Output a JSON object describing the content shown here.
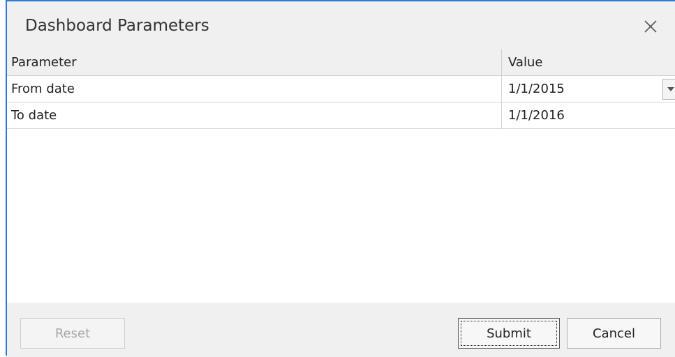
{
  "dialog": {
    "title": "Dashboard Parameters"
  },
  "grid": {
    "columns": {
      "parameter": "Parameter",
      "value": "Value"
    },
    "rows": [
      {
        "parameter": "From date",
        "value": "1/1/2015",
        "has_dropdown": true
      },
      {
        "parameter": "To date",
        "value": "1/1/2016",
        "has_dropdown": false
      }
    ]
  },
  "buttons": {
    "reset": "Reset",
    "submit": "Submit",
    "cancel": "Cancel"
  },
  "colors": {
    "accent_border": "#2b7ad6",
    "disabled_text": "#a8a8a8"
  },
  "icons": {
    "close": "close-icon",
    "dropdown": "chevron-down-icon"
  }
}
